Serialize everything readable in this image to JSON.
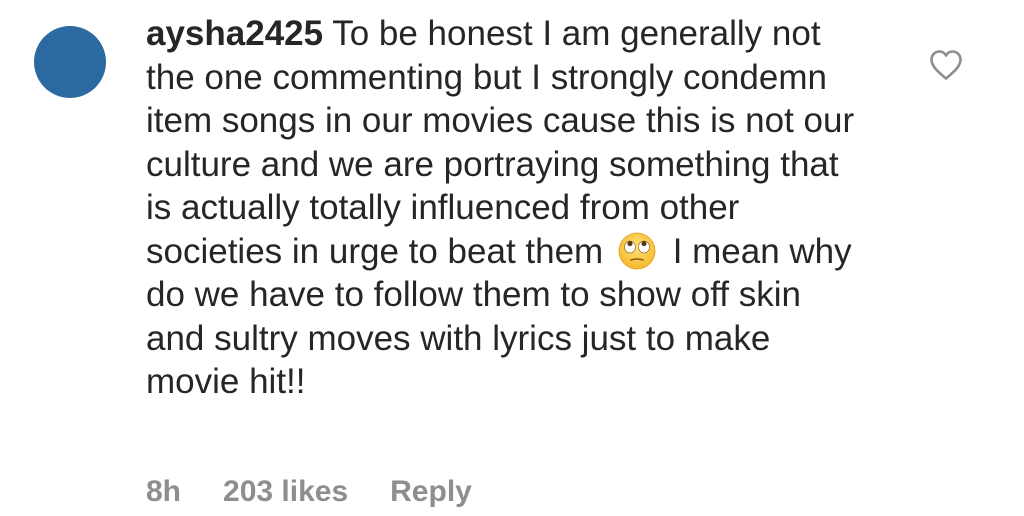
{
  "comment": {
    "username": "aysha2425",
    "text_before_emoji": "To be honest I am generally not the one commenting but I strongly condemn item songs in our movies cause this is not our culture and we are portraying something that is actually totally influenced from other societies in urge to beat them",
    "emoji": "face-with-rolling-eyes",
    "text_after_emoji": "I mean why do we have to follow them to show off skin and sultry moves with lyrics just to make movie hit!!",
    "time": "8h",
    "likes": "203 likes",
    "reply_label": "Reply",
    "like_icon": "heart-outline-icon"
  },
  "colors": {
    "avatar": "#2a6aa0",
    "text": "#262626",
    "meta": "#8e8e8e",
    "heart": "#8e8e8e"
  }
}
